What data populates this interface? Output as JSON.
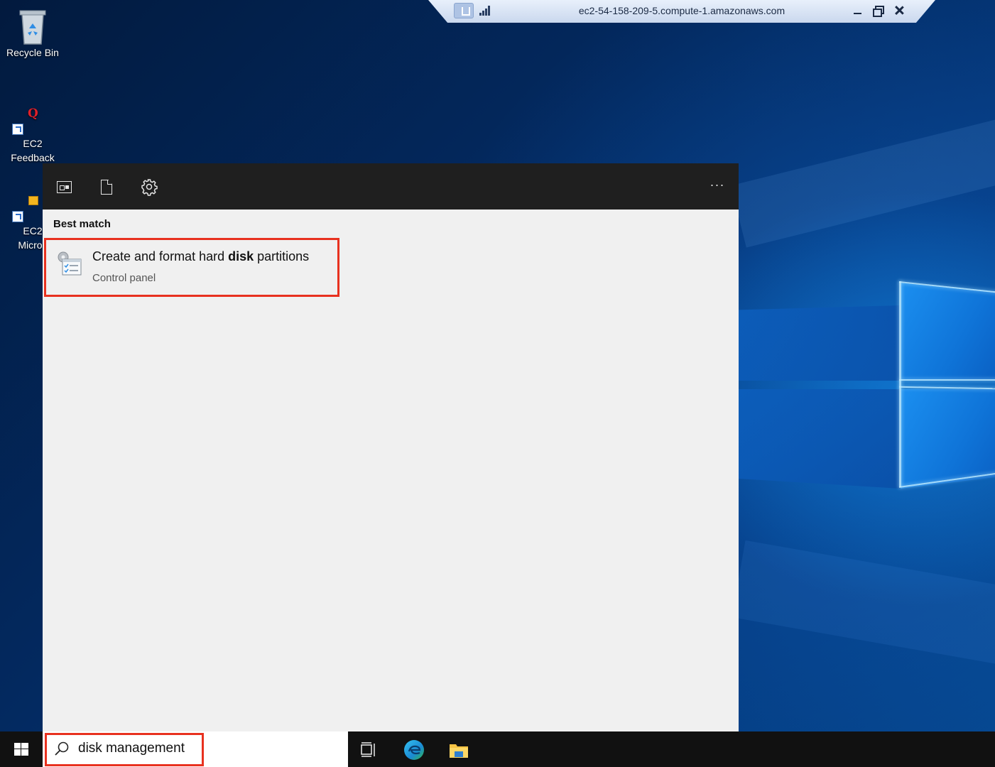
{
  "desktop": {
    "icons": [
      {
        "label": "Recycle Bin"
      },
      {
        "label_line1": "EC2",
        "label_line2": "Feedback"
      },
      {
        "label_line1": "EC2",
        "label_line2": "Micros"
      }
    ]
  },
  "rdp_bar": {
    "hostname": "ec2-54-158-209-5.compute-1.amazonaws.com"
  },
  "search_panel": {
    "toolbar": {
      "filters": [
        "apps-icon",
        "documents-icon",
        "settings-icon"
      ],
      "more_label": "···"
    },
    "best_match_header": "Best match",
    "best_match": {
      "title_before": "Create and format hard ",
      "title_bold": "disk",
      "title_after": " partitions",
      "subtitle": "Control panel"
    }
  },
  "taskbar": {
    "search_value": "disk management",
    "pinned": [
      "task-view-icon",
      "edge-icon",
      "file-explorer-icon"
    ]
  },
  "colors": {
    "highlight": "#e8311f",
    "panel_bg": "#f0f0f0",
    "toolbar_bg": "#1f1f1f",
    "taskbar_bg": "#111111"
  }
}
